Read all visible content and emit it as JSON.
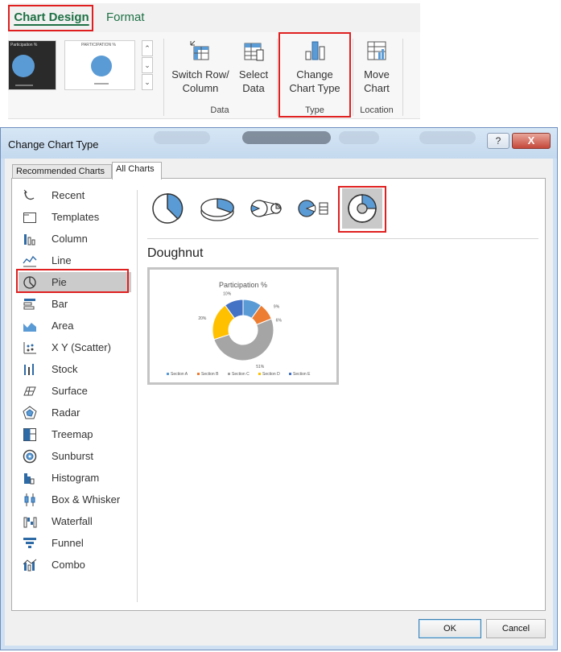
{
  "ribbon": {
    "tabs": [
      {
        "label": "Chart Design",
        "active": true
      },
      {
        "label": "Format",
        "active": false
      }
    ],
    "buttons": {
      "switch_row_column": {
        "line1": "Switch Row/",
        "line2": "Column",
        "icon": "switch-row-column-icon"
      },
      "select_data": {
        "line1": "Select",
        "line2": "Data",
        "icon": "select-data-icon"
      },
      "change_chart_type": {
        "line1": "Change",
        "line2": "Chart Type",
        "icon": "change-chart-type-icon"
      },
      "move_chart": {
        "line1": "Move",
        "line2": "Chart",
        "icon": "move-chart-icon"
      }
    },
    "groups": {
      "data": "Data",
      "type": "Type",
      "location": "Location"
    }
  },
  "dialog": {
    "title": "Change Chart Type",
    "help_label": "?",
    "close_label": "X",
    "tabs": [
      {
        "label": "Recommended Charts",
        "active": false
      },
      {
        "label": "All Charts",
        "active": true
      }
    ],
    "chart_types": [
      {
        "label": "Recent",
        "icon": "recent-icon"
      },
      {
        "label": "Templates",
        "icon": "templates-icon"
      },
      {
        "label": "Column",
        "icon": "column-chart-icon"
      },
      {
        "label": "Line",
        "icon": "line-chart-icon"
      },
      {
        "label": "Pie",
        "icon": "pie-chart-icon",
        "selected": true
      },
      {
        "label": "Bar",
        "icon": "bar-chart-icon"
      },
      {
        "label": "Area",
        "icon": "area-chart-icon"
      },
      {
        "label": "X Y (Scatter)",
        "icon": "scatter-chart-icon"
      },
      {
        "label": "Stock",
        "icon": "stock-chart-icon"
      },
      {
        "label": "Surface",
        "icon": "surface-chart-icon"
      },
      {
        "label": "Radar",
        "icon": "radar-chart-icon"
      },
      {
        "label": "Treemap",
        "icon": "treemap-chart-icon"
      },
      {
        "label": "Sunburst",
        "icon": "sunburst-chart-icon"
      },
      {
        "label": "Histogram",
        "icon": "histogram-chart-icon"
      },
      {
        "label": "Box & Whisker",
        "icon": "box-whisker-chart-icon"
      },
      {
        "label": "Waterfall",
        "icon": "waterfall-chart-icon"
      },
      {
        "label": "Funnel",
        "icon": "funnel-chart-icon"
      },
      {
        "label": "Combo",
        "icon": "combo-chart-icon"
      }
    ],
    "subtypes": [
      {
        "icon": "pie-subtype-icon"
      },
      {
        "icon": "3d-pie-subtype-icon"
      },
      {
        "icon": "pie-of-pie-subtype-icon"
      },
      {
        "icon": "bar-of-pie-subtype-icon"
      },
      {
        "icon": "doughnut-subtype-icon",
        "selected": true
      }
    ],
    "selected_type_name": "Doughnut",
    "ok_label": "OK",
    "cancel_label": "Cancel"
  },
  "colors": {
    "accent_green": "#1e7145",
    "highlight_red": "#e02020",
    "section_a": "#5b9bd5",
    "section_b": "#ed7d31",
    "section_c": "#a5a5a5",
    "section_d": "#ffc000",
    "section_e": "#4472c4"
  },
  "chart_data": {
    "type": "doughnut",
    "title": "Participation %",
    "categories": [
      "Section A",
      "Section B",
      "Section C",
      "Section D",
      "Section E"
    ],
    "values": [
      10,
      9,
      51,
      20,
      10
    ],
    "data_labels": [
      "",
      "9%",
      "51%",
      "20%",
      "10%"
    ],
    "extra_label": "6%",
    "legend_position": "bottom"
  }
}
